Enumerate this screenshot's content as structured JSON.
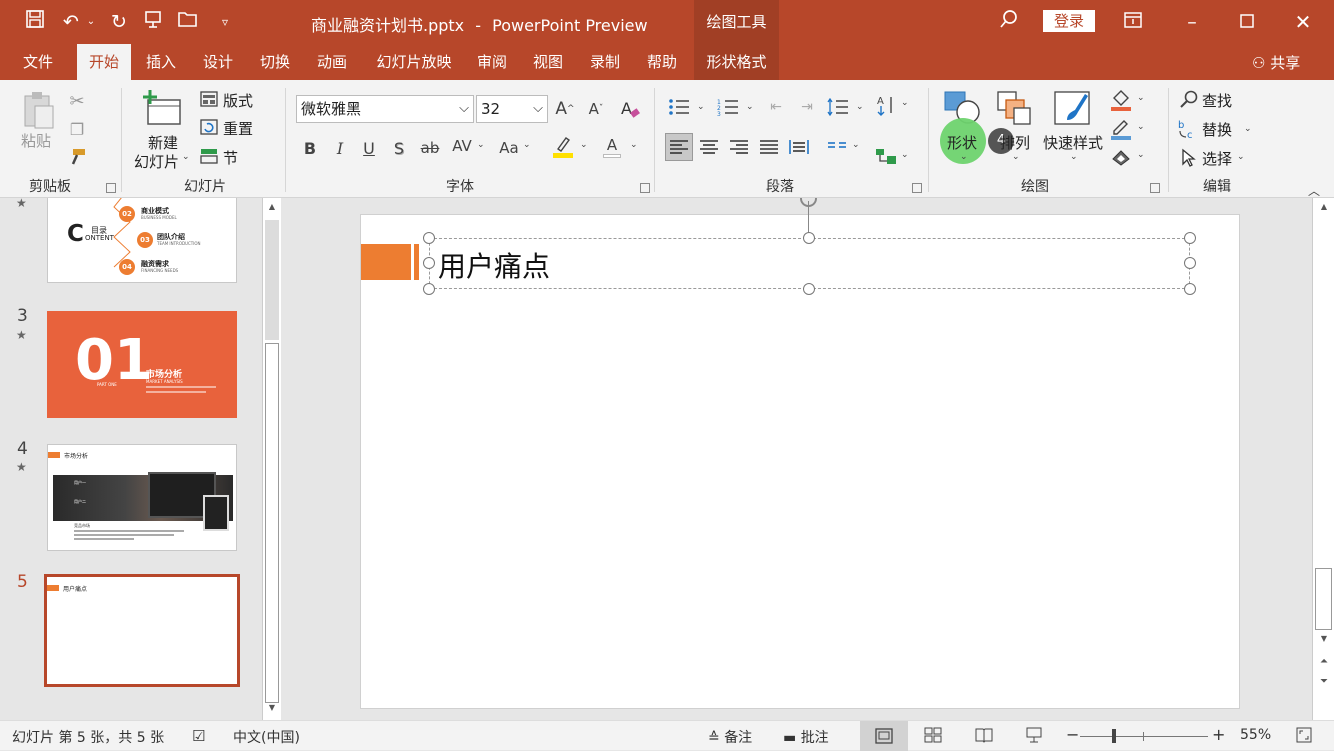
{
  "titlebar": {
    "filename": "商业融资计划书.pptx",
    "separator": "-",
    "app": "PowerPoint Preview",
    "context_tab": "绘图工具",
    "login": "登录"
  },
  "tabs": {
    "file": "文件",
    "home": "开始",
    "insert": "插入",
    "design": "设计",
    "transitions": "切换",
    "animations": "动画",
    "slideshow": "幻灯片放映",
    "review": "审阅",
    "view": "视图",
    "record": "录制",
    "help": "帮助",
    "shape_format": "形状格式",
    "share": "共享"
  },
  "ribbon": {
    "clipboard": {
      "paste": "粘贴",
      "label": "剪贴板"
    },
    "slides": {
      "new_slide_l1": "新建",
      "new_slide_l2": "幻灯片",
      "layout": "版式",
      "reset": "重置",
      "section": "节",
      "label": "幻灯片"
    },
    "font": {
      "name": "微软雅黑",
      "size": "32",
      "bold": "B",
      "italic": "I",
      "underline": "U",
      "shadow": "S",
      "strike": "ab",
      "spacing": "AV",
      "case": "Aa",
      "grow": "A",
      "shrink": "A",
      "color": "A",
      "label": "字体"
    },
    "paragraph": {
      "label": "段落"
    },
    "drawing": {
      "shapes": "形状",
      "arrange": "排列",
      "badge": "4",
      "quick_styles": "快速样式",
      "label": "绘图"
    },
    "editing": {
      "find": "查找",
      "replace": "替换",
      "select": "选择",
      "label": "编辑"
    }
  },
  "thumbnails": {
    "t2": {
      "c_letter": "C",
      "c_title": "目录",
      "c_sub": "ONTENT",
      "items": [
        {
          "no": "02",
          "title": "商业模式",
          "sub": "BUSINESS MODEL"
        },
        {
          "no": "03",
          "title": "团队介绍",
          "sub": "TEAM INTRODUCTION"
        },
        {
          "no": "04",
          "title": "融资需求",
          "sub": "FINANCING NEEDS"
        }
      ]
    },
    "t3": {
      "num": "3",
      "big": "01",
      "title": "市场分析",
      "sub": "MARKET ANALYSIS",
      "part": "PART ONE"
    },
    "t4": {
      "num": "4",
      "title": "市场分析",
      "block1": "用户一",
      "block2": "用户二",
      "block3": "竞品市场"
    },
    "t5": {
      "num": "5",
      "title": "用户痛点"
    }
  },
  "slide": {
    "title": "用户痛点"
  },
  "status": {
    "slide_info": "幻灯片 第 5 张，共 5 张",
    "language": "中文(中国)",
    "notes": "备注",
    "comments": "批注",
    "zoom": "55%",
    "minus": "−",
    "plus": "+"
  },
  "colors": {
    "accent": "#b7472a",
    "orange": "#ed7d31",
    "thumb_red": "#e8623c",
    "highlight": "#6ed36e"
  }
}
